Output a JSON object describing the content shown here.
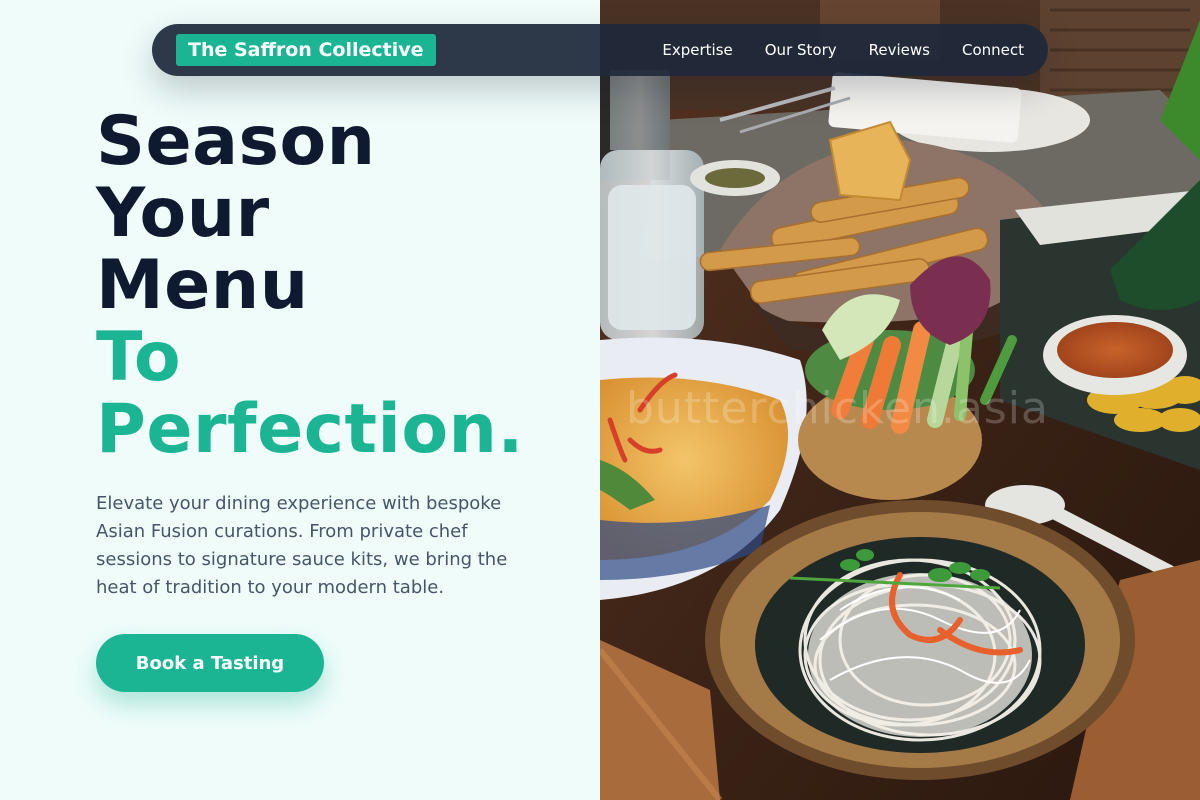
{
  "brand": {
    "name": "The Saffron Collective"
  },
  "nav": {
    "links": [
      "Expertise",
      "Our Story",
      "Reviews",
      "Connect"
    ]
  },
  "hero": {
    "headline_lines": [
      "Season",
      "Your",
      "Menu"
    ],
    "headline_accent_lines": [
      "To",
      "Perfection."
    ],
    "description": "Elevate your dining experience with bespoke Asian Fusion curations. From private chef sessions to signature sauce kits, we bring the heat of tradition to your modern table.",
    "cta_label": "Book a Tasting"
  },
  "image": {
    "watermark": "butterchicken.asia"
  },
  "colors": {
    "accent": "#1cb594",
    "heading": "#0f1a30",
    "navbar": "#1e293b",
    "body_text": "#475569",
    "background": "#effcfa"
  }
}
